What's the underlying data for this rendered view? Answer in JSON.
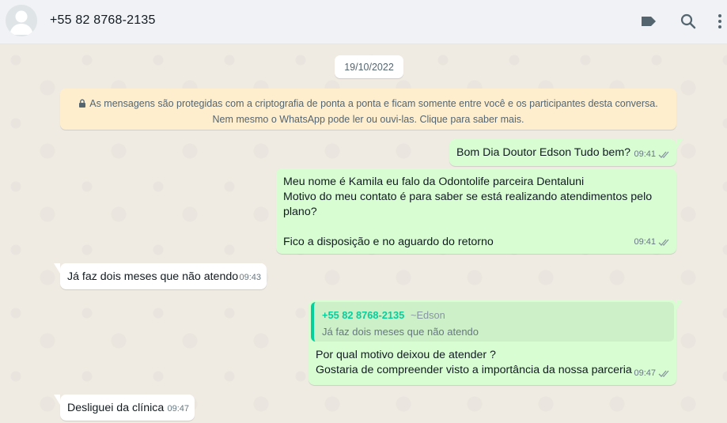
{
  "header": {
    "contact_name": "+55 82 8768-2135",
    "icons": [
      "avatar-placeholder",
      "label-icon",
      "search-icon",
      "menu-icon"
    ]
  },
  "chat": {
    "date": "19/10/2022",
    "encryption_notice_line1": "As mensagens são protegidas com a criptografia de ponta a ponta e ficam somente entre você e os participantes desta conversa.",
    "encryption_notice_line2": "Nem mesmo o WhatsApp pode ler ou ouvi-las. Clique para saber mais.",
    "messages": [
      {
        "direction": "out",
        "text": "Bom Dia Doutor Edson Tudo bem?",
        "time": "09:41",
        "status": "read"
      },
      {
        "direction": "out",
        "text": "Meu nome é Kamila eu falo da Odontolife parceira Dentaluni\nMotivo do meu contato é para saber se está realizando atendimentos pelo\nplano?\n\nFico a disposição e no aguardo do retorno",
        "time": "09:41",
        "status": "read"
      },
      {
        "direction": "in",
        "text": "Já faz dois meses que não atendo",
        "time": "09:43"
      },
      {
        "direction": "out",
        "quote_name": "+55 82 8768-2135",
        "quote_alias": "~Edson",
        "quote_text": "Já faz dois meses que não atendo",
        "text": "Por qual motivo deixou de atender ?\nGostaria de compreender visto a importância da nossa parceria",
        "time": "09:47",
        "status": "read"
      },
      {
        "direction": "in",
        "text": "Desliguei da clínica",
        "time": "09:47"
      }
    ]
  },
  "colors": {
    "outgoing_bubble": "#d9fdd3",
    "incoming_bubble": "#ffffff",
    "chat_background": "#efeae2",
    "notice_background": "#ffeecd",
    "quote_accent": "#06cf9c",
    "header_background": "#f0f2f5"
  }
}
